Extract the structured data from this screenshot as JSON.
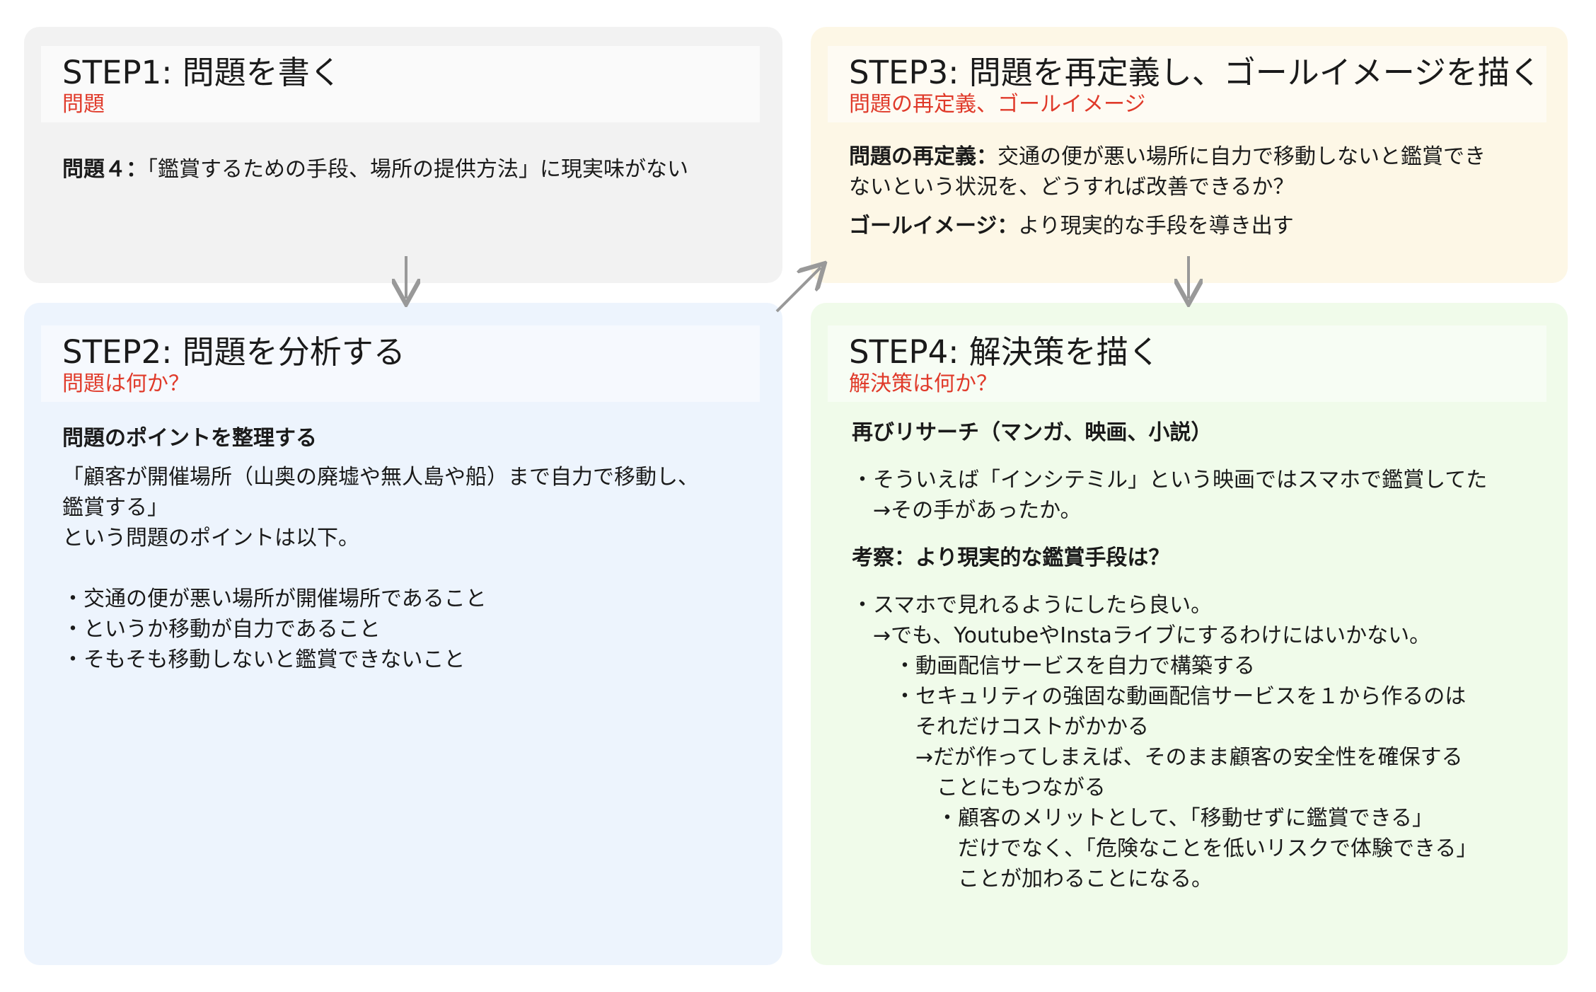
{
  "colors": {
    "step1_bg": "#f2f2f2",
    "step2_bg": "#edf4fd",
    "step3_bg": "#fdf7e6",
    "step4_bg": "#f0fbea",
    "subtitle_red": "#e03a2a",
    "arrow_gray": "#999999"
  },
  "step1": {
    "title": "STEP1: 問題を書く",
    "subtitle": "問題",
    "problem_label": "問題４：",
    "problem_text": "「鑑賞するための手段、場所の提供方法」に現実味がない"
  },
  "step2": {
    "title": "STEP2: 問題を分析する",
    "subtitle": "問題は何か？",
    "heading": "問題のポイントを整理する",
    "lines": [
      "「顧客が開催場所（山奥の廃墟や無人島や船）まで自力で移動し、",
      "鑑賞する」",
      "という問題のポイントは以下。"
    ],
    "bullets": [
      "・交通の便が悪い場所が開催場所であること",
      "・というか移動が自力であること",
      "・そもそも移動しないと鑑賞できないこと"
    ]
  },
  "step3": {
    "title": "STEP3: 問題を再定義し、ゴールイメージを描く",
    "subtitle": "問題の再定義、ゴールイメージ",
    "redefine_label": "問題の再定義：",
    "redefine_line1": "交通の便が悪い場所に自力で移動しないと鑑賞でき",
    "redefine_line2": "ないという状況を、どうすれば改善できるか？",
    "goal_label": "ゴールイメージ：",
    "goal_text": "より現実的な手段を導き出す"
  },
  "step4": {
    "title": "STEP4: 解決策を描く",
    "subtitle": "解決策は何か？",
    "heading1": "再びリサーチ（マンガ、映画、小説）",
    "research_lines": [
      "・そういえば「インシテミル」という映画ではスマホで鑑賞してた",
      "　→その手があったか。"
    ],
    "heading2": "考察：より現実的な鑑賞手段は？",
    "analysis_lines": [
      "・スマホで見れるようにしたら良い。",
      "　→でも、YoutubeやInstaライブにするわけにはいかない。",
      "　　・動画配信サービスを自力で構築する",
      "　　・セキュリティの強固な動画配信サービスを１から作るのは",
      "　　　それだけコストがかかる",
      "　　　→だが作ってしまえば、そのまま顧客の安全性を確保する",
      "　　　　ことにもつながる",
      "　　　　・顧客のメリットとして、「移動せずに鑑賞できる」",
      "　　　　　だけでなく、「危険なことを低いリスクで体験できる」",
      "　　　　　ことが加わることになる。"
    ]
  }
}
